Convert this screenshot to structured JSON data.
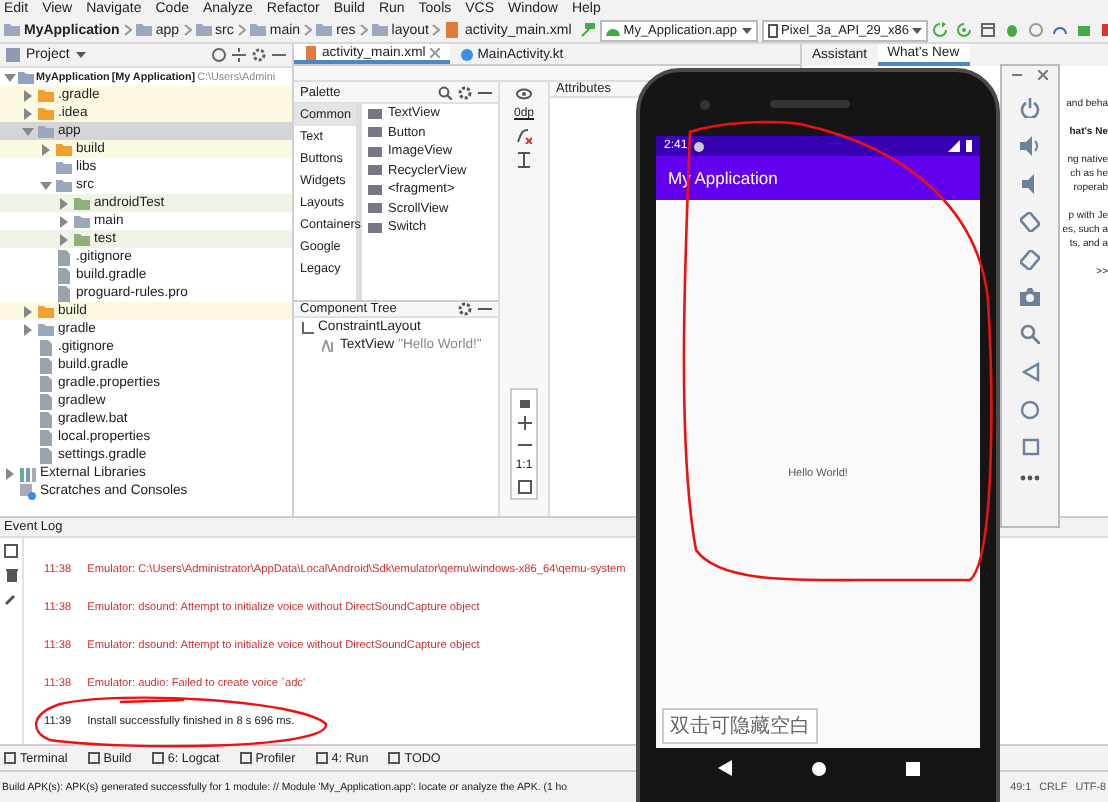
{
  "menu_bar": [
    "Edit",
    "View",
    "Navigate",
    "Code",
    "Analyze",
    "Refactor",
    "Build",
    "Run",
    "Tools",
    "VCS",
    "Window",
    "Help"
  ],
  "breadcrumbs": [
    "MyApplication",
    "app",
    "src",
    "main",
    "res",
    "layout",
    "activity_main.xml"
  ],
  "run_config": "My_Application.app",
  "device": "Pixel_3a_API_29_x86",
  "project_panel": {
    "title": "Project",
    "tree": [
      {
        "label": "MyApplication",
        "extra": "[My Application]",
        "path": "C:\\Users\\Admini",
        "kind": "root",
        "expanded": true,
        "selected": false,
        "children": [
          {
            "label": ".gradle",
            "kind": "folder",
            "expanded": false,
            "selected": false,
            "excluded": true
          },
          {
            "label": ".idea",
            "kind": "folder",
            "expanded": false,
            "selected": false,
            "excluded": true
          },
          {
            "label": "app",
            "kind": "folder",
            "expanded": true,
            "selected": true,
            "children": [
              {
                "label": "build",
                "kind": "folder",
                "expanded": false,
                "selected": false,
                "excluded": true
              },
              {
                "label": "libs",
                "kind": "leaf_folder",
                "selected": false
              },
              {
                "label": "src",
                "kind": "folder",
                "expanded": true,
                "selected": false,
                "children": [
                  {
                    "label": "androidTest",
                    "kind": "folder",
                    "expanded": false,
                    "selected": false,
                    "test_source": true
                  },
                  {
                    "label": "main",
                    "kind": "folder",
                    "expanded": false,
                    "selected": false
                  },
                  {
                    "label": "test",
                    "kind": "folder",
                    "expanded": false,
                    "selected": false,
                    "test_source": true
                  }
                ]
              },
              {
                "label": ".gitignore",
                "kind": "file",
                "selected": false
              },
              {
                "label": "build.gradle",
                "kind": "file",
                "selected": false
              },
              {
                "label": "proguard-rules.pro",
                "kind": "file",
                "selected": false
              }
            ]
          },
          {
            "label": "build",
            "kind": "folder",
            "expanded": false,
            "selected": false,
            "excluded": true
          },
          {
            "label": "gradle",
            "kind": "folder",
            "expanded": false,
            "selected": false
          },
          {
            "label": ".gitignore",
            "kind": "file",
            "selected": false
          },
          {
            "label": "build.gradle",
            "kind": "file",
            "selected": false
          },
          {
            "label": "gradle.properties",
            "kind": "file",
            "selected": false
          },
          {
            "label": "gradlew",
            "kind": "file",
            "selected": false
          },
          {
            "label": "gradlew.bat",
            "kind": "file",
            "selected": false
          },
          {
            "label": "local.properties",
            "kind": "file",
            "selected": false
          },
          {
            "label": "settings.gradle",
            "kind": "file",
            "selected": false
          }
        ]
      },
      {
        "label": "External Libraries",
        "kind": "library",
        "expanded": false,
        "selected": false
      },
      {
        "label": "Scratches and Consoles",
        "kind": "scratch",
        "selected": false
      }
    ]
  },
  "editor_tabs": [
    {
      "label": "activity_main.xml",
      "selected": true
    },
    {
      "label": "MainActivity.kt",
      "selected": false
    }
  ],
  "palette": {
    "title": "Palette",
    "categories": [
      {
        "label": "Common",
        "selected": true
      },
      {
        "label": "Text",
        "selected": false
      },
      {
        "label": "Buttons",
        "selected": false
      },
      {
        "label": "Widgets",
        "selected": false
      },
      {
        "label": "Layouts",
        "selected": false
      },
      {
        "label": "Containers",
        "selected": false
      },
      {
        "label": "Google",
        "selected": false
      },
      {
        "label": "Legacy",
        "selected": false
      }
    ],
    "items": [
      "TextView",
      "Button",
      "ImageView",
      "RecyclerView",
      "<fragment>",
      "ScrollView",
      "Switch"
    ]
  },
  "component_tree": {
    "title": "Component Tree",
    "nodes": [
      {
        "label": "ConstraintLayout",
        "children": [
          {
            "label": "TextView",
            "detail": "\"Hello World!\""
          }
        ]
      }
    ]
  },
  "design_strip": {
    "dimension": "0dp",
    "zoom_ratio": "1:1"
  },
  "attributes": {
    "title": "Attributes"
  },
  "assistant": {
    "tabs": [
      {
        "label": "Assistant",
        "selected": false
      },
      {
        "label": "What's New",
        "selected": true
      }
    ],
    "paragraphs": [
      {
        "kind": "text",
        "lines": [
          "and beha"
        ]
      },
      {
        "kind": "heading",
        "lines": [
          "hat's Ne"
        ]
      },
      {
        "kind": "text",
        "lines": [
          "ng native",
          "ch as he",
          "roperab"
        ]
      },
      {
        "kind": "text",
        "lines": [
          "p with Je",
          "es, such a",
          "ts, and a"
        ]
      },
      {
        "kind": "text",
        "lines": [
          ">>"
        ]
      }
    ]
  },
  "event_log": {
    "title": "Event Log",
    "entries": [
      {
        "time": "11:38",
        "message": "Emulator: C:\\Users\\Administrator\\AppData\\Local\\Android\\Sdk\\emulator\\qemu\\windows-x86_64\\qemu-system",
        "kind": "error"
      },
      {
        "time": "11:38",
        "message": "Emulator: dsound: Attempt to initialize voice without DirectSoundCapture object",
        "kind": "error"
      },
      {
        "time": "11:38",
        "message": "Emulator: dsound: Attempt to initialize voice without DirectSoundCapture object",
        "kind": "error"
      },
      {
        "time": "11:38",
        "message": "Emulator: audio: Failed to create voice `adc'",
        "kind": "error"
      },
      {
        "time": "11:39",
        "message": "Install successfully finished in 8 s 696 ms.",
        "kind": "info"
      }
    ]
  },
  "tool_windows": [
    "Terminal",
    "Build",
    "6: Logcat",
    "Profiler",
    "4: Run",
    "TODO"
  ],
  "status_bar": {
    "message": "Build APK(s): APK(s) generated successfully for 1 module: // Module 'My_Application.app': locate or analyze the APK. (1 ho",
    "items": [
      "49:1",
      "CRLF",
      "UTF-8"
    ]
  },
  "emulator": {
    "time": "2:41",
    "app_title": "My Application",
    "content_text": "Hello World!",
    "toast": "双击可隐藏空白"
  }
}
